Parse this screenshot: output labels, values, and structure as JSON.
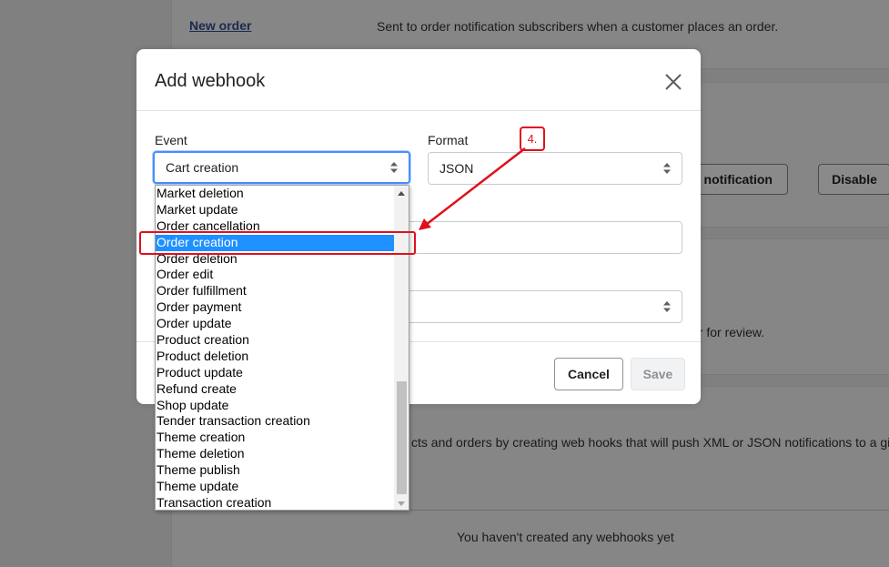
{
  "background": {
    "new_order_link": "New order",
    "new_order_desc": "Sent to order notification subscribers when a customer places an order.",
    "send_test_btn": "t notification",
    "disable_btn": "Disable",
    "review_text": "er for review.",
    "webhooks_desc": "cts and orders by creating web hooks that will push XML or JSON notifications to a gi",
    "empty_state": "You haven't created any webhooks yet"
  },
  "modal": {
    "title": "Add webhook",
    "event_label": "Event",
    "event_value": "Cart creation",
    "format_label": "Format",
    "format_value": "JSON",
    "cancel_label": "Cancel",
    "save_label": "Save"
  },
  "dropdown": {
    "items": [
      "Market deletion",
      "Market update",
      "Order cancellation",
      "Order creation",
      "Order deletion",
      "Order edit",
      "Order fulfillment",
      "Order payment",
      "Order update",
      "Product creation",
      "Product deletion",
      "Product update",
      "Refund create",
      "Shop update",
      "Tender transaction creation",
      "Theme creation",
      "Theme deletion",
      "Theme publish",
      "Theme update",
      "Transaction creation"
    ],
    "selected_index": 3
  },
  "annotation": {
    "step_label": "4.",
    "color": "#e0101b"
  }
}
